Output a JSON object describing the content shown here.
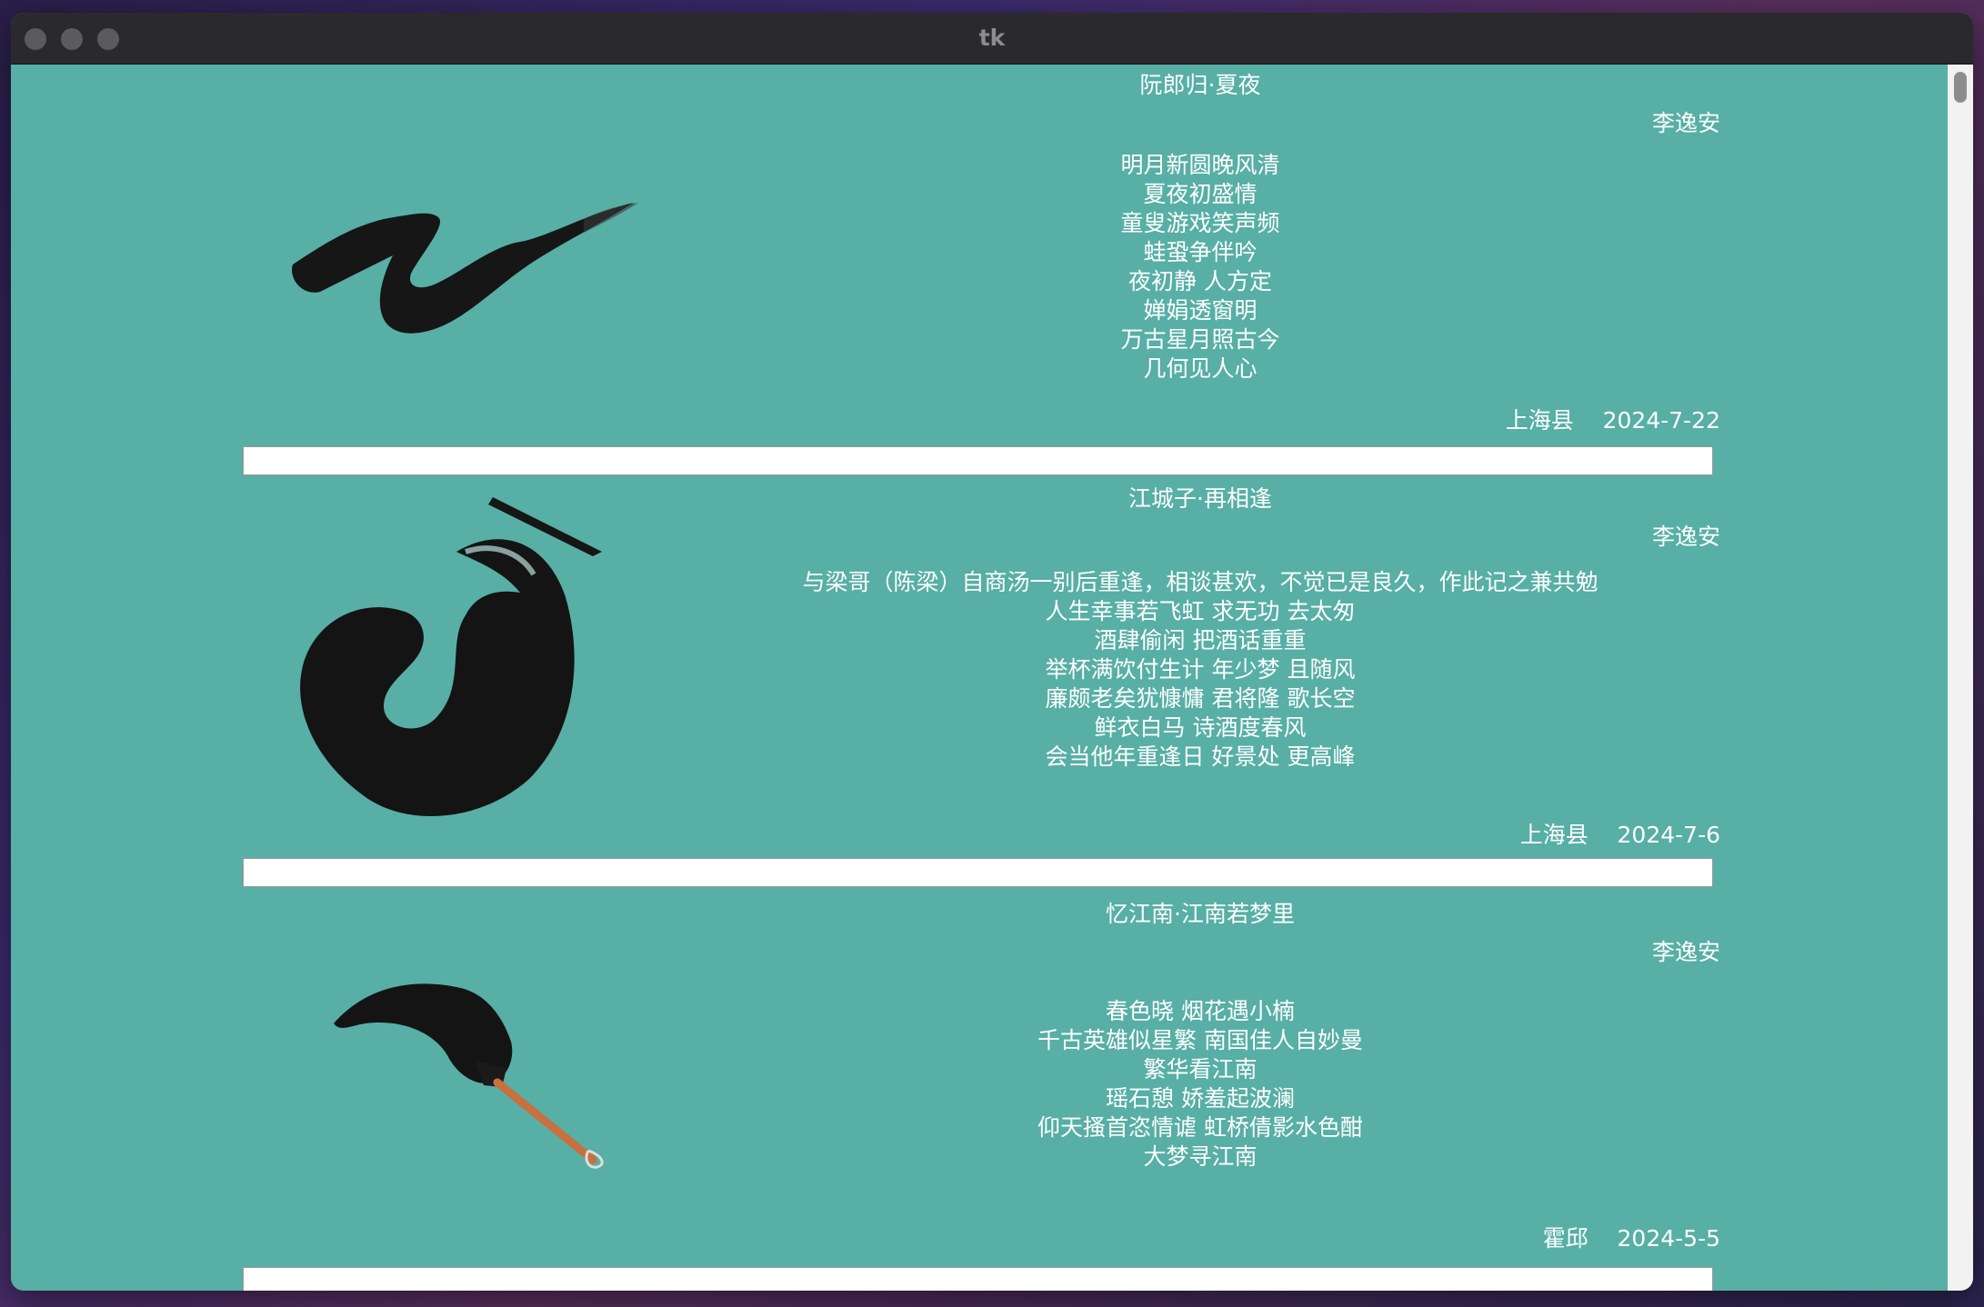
{
  "window": {
    "title": "tk"
  },
  "poems": [
    {
      "title": "阮郎归·夏夜",
      "author": "李逸安",
      "lines": [
        "明月新圆晚风清",
        "夏夜初盛情",
        "童叟游戏笑声频",
        "蛙蛩争伴吟",
        "夜初静 人方定",
        "婵娟透窗明",
        "万古星月照古今",
        "几何见人心"
      ],
      "place": "上海县",
      "date": "2024-7-22"
    },
    {
      "title": "江城子·再相逢",
      "author": "李逸安",
      "lines": [
        "与梁哥（陈梁）自商汤一别后重逢，相谈甚欢，不觉已是良久，作此记之兼共勉",
        "人生幸事若飞虹 求无功 去太匆",
        "酒肆偷闲 把酒话重重",
        "举杯满饮付生计 年少梦 且随风",
        "廉颇老矣犹慷慵 君将隆 歌长空",
        "鲜衣白马 诗酒度春风",
        "会当他年重逢日 好景处 更高峰"
      ],
      "place": "上海县",
      "date": "2024-7-6"
    },
    {
      "title": "忆江南·江南若梦里",
      "author": "李逸安",
      "lines": [
        "春色晓 烟花遇小楠",
        "千古英雄似星繁 南国佳人自妙曼",
        "繁华看江南",
        "瑶石憩 娇羞起波澜",
        "仰天搔首恣情谑 虹桥倩影水色酣",
        "大梦寻江南"
      ],
      "place": "霍邱",
      "date": "2024-5-5"
    }
  ],
  "colors": {
    "background": "#57afa6",
    "text": "#ffffff",
    "divider": "#ffffff",
    "titlebar": "#2a2a2c"
  },
  "icons": [
    "close-traffic-light",
    "minimize-traffic-light",
    "zoom-traffic-light",
    "ink-brush-stroke-icon",
    "ink-swirl-icon",
    "calligraphy-brush-icon"
  ]
}
